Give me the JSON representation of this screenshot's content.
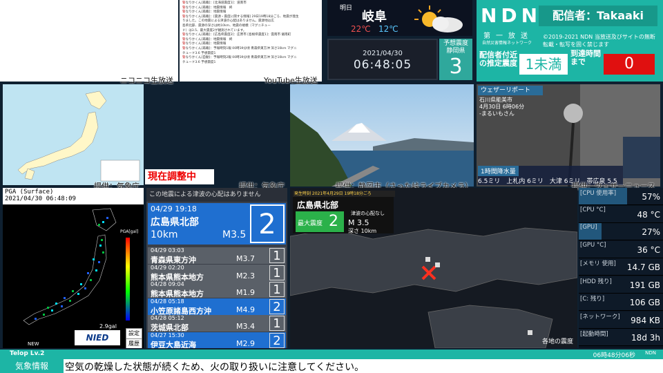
{
  "panels": {
    "nico_label": "ニコニコ生放送",
    "youtube_label": "YouTube生放送",
    "kishocho1": "提供：気象庁",
    "kishocho2": "提供：気象庁",
    "shizuoka": "提供：静岡市（さった峠ライブカメラ）",
    "weathernews": "提供：ウェザーニュース"
  },
  "comments": [
    {
      "k": "警",
      "t": "なりかくん[再載]：[北海道震度1]：道南市"
    },
    {
      "k": "警",
      "t": "なりかくん[再載]：地震情報　終"
    },
    {
      "k": "警",
      "t": "なりかくん[再載]：地震情報"
    },
    {
      "k": "警",
      "t": "なりかくん[再載]：[震源・震度に関する情報] 29日19時18分ごろ、地震が発生"
    },
    {
      "k": "",
      "t": "りました。この地震による津波の心配はありません。震源地は広"
    },
    {
      "k": "",
      "t": "島県北部、震源の深さは約10km、地震の規模（マグニチュー"
    },
    {
      "k": "",
      "t": "ド）は3.5、最大震度2が観測されています。"
    },
    {
      "k": "警",
      "t": "なりかくん[再載]：[広島県震度2]：庄原市 [島根県震度1]：雲南市 飯南町"
    },
    {
      "k": "警",
      "t": "なりかくん[再載]：地震情報　終"
    },
    {
      "k": "警",
      "t": "なりかくん[再載]：地震情報"
    },
    {
      "k": "警",
      "t": "なりかくん[再載]：予報時刻1報 00時39分頃 青森県東方沖 深さ10km マグニ"
    },
    {
      "k": "",
      "t": "チュード3.6 予想震度1"
    },
    {
      "k": "警",
      "t": "なりかくん[自動]：予報時刻2報 00時39分頃 青森県東方沖 深さ10km マグニ"
    },
    {
      "k": "",
      "t": "チュード3.6 予想震度1"
    }
  ],
  "weather": {
    "day": "明日",
    "city": "岐阜",
    "high": "22℃",
    "low": "12℃"
  },
  "clock": {
    "date": "2021/04/30",
    "time": "06:48:05"
  },
  "predicted": {
    "label1": "予想震度",
    "label2": "静岡県",
    "value": "3"
  },
  "ndn": {
    "logo": "NDN",
    "sub": "第一放送",
    "sub2": "自然災害情報ネットワーク",
    "caster": "配信者：Takaaki",
    "copy": "©2019-2021 NDN 当放送及びサイトの無断転載・転写を固く禁じます",
    "est_label": "配信者付近の推定震度",
    "est_value": "1未満",
    "arr_label": "到達時間まで",
    "arr_value": "0"
  },
  "adjust": "現在調整中",
  "weather_report": {
    "header": "ウェザーリポート",
    "loc1": "石川県能美市",
    "loc2": "4月30日 6時06分",
    "loc3": "-まるいもさん",
    "rain_header": "1時間降水量",
    "rain": "6.5ミリ　上札内 6ミリ　大津 6ミリ　帯広泉 5.5ミリ"
  },
  "pga": {
    "title": "PGA (Surface)",
    "time": "2021/04/30 06:48:09",
    "max": "2.9gal",
    "unit": "PGA[gal]",
    "btn1": "設定",
    "btn2": "履歴",
    "nied": "NIED",
    "new": "NEW"
  },
  "quakes": {
    "header": "この地震による津波の心配はありません",
    "main": {
      "dt": "04/29 19:18",
      "place": "広島県北部",
      "depth": "10km",
      "mag": "M3.5",
      "shindo": "2"
    },
    "list": [
      {
        "dt": "04/29 03:03",
        "place": "青森県東方沖",
        "mag": "M3.7",
        "shindo": "1",
        "blue": false
      },
      {
        "dt": "04/29 02:20",
        "place": "熊本県熊本地方",
        "mag": "M2.3",
        "shindo": "1",
        "blue": false
      },
      {
        "dt": "04/28 09:04",
        "place": "熊本県熊本地方",
        "mag": "M1.9",
        "shindo": "1",
        "blue": false
      },
      {
        "dt": "04/28 05:18",
        "place": "小笠原諸島西方沖",
        "mag": "M4.9",
        "shindo": "2",
        "blue": true
      },
      {
        "dt": "04/28 05:12",
        "place": "茨城県北部",
        "mag": "M3.4",
        "shindo": "1",
        "blue": false
      },
      {
        "dt": "04/27 15:30",
        "place": "伊豆大島近海",
        "mag": "M2.9",
        "shindo": "2",
        "blue": true
      }
    ]
  },
  "qmap": {
    "time": "発生時刻 2021年4月29日 19時18分ごろ",
    "place": "広島県北部",
    "int_label": "最大震度",
    "int": "2",
    "tsunami": "津波の心配なし",
    "mag": "M 3.5",
    "depth": "深さ 10km",
    "legend": "各地の震度"
  },
  "stats": [
    {
      "label": "[CPU 使用率]",
      "value": "57%",
      "fill": 0.57
    },
    {
      "label": "[CPU °C]",
      "value": "48 °C",
      "fill": 0.0
    },
    {
      "label": "[GPU]",
      "value": "27%",
      "fill": 0.27
    },
    {
      "label": "[GPU °C]",
      "value": "36 °C",
      "fill": 0.0
    },
    {
      "label": "[メモリ 使用]",
      "value": "14.7 GB",
      "fill": 0.0
    },
    {
      "label": "[HDD 残り]",
      "value": "191 GB",
      "fill": 0.0
    },
    {
      "label": "[C: 残り]",
      "value": "106 GB",
      "fill": 0.0
    },
    {
      "label": "[ネットワーク]",
      "value": "984 KB",
      "fill": 0.0
    },
    {
      "label": "[起動時間]",
      "value": "18d 3h",
      "fill": 0.0
    }
  ],
  "telop": {
    "level": "Telop Lv.2",
    "time": "06時48分06秒",
    "ndn": "NDN"
  },
  "ticker": {
    "label": "気象情報",
    "text": "空気の乾燥した状態が続くため、火の取り扱いに注意してください。"
  },
  "colors": {
    "teal": "#1db5a5",
    "red": "#e01010",
    "blue": "#1f6fd0"
  }
}
